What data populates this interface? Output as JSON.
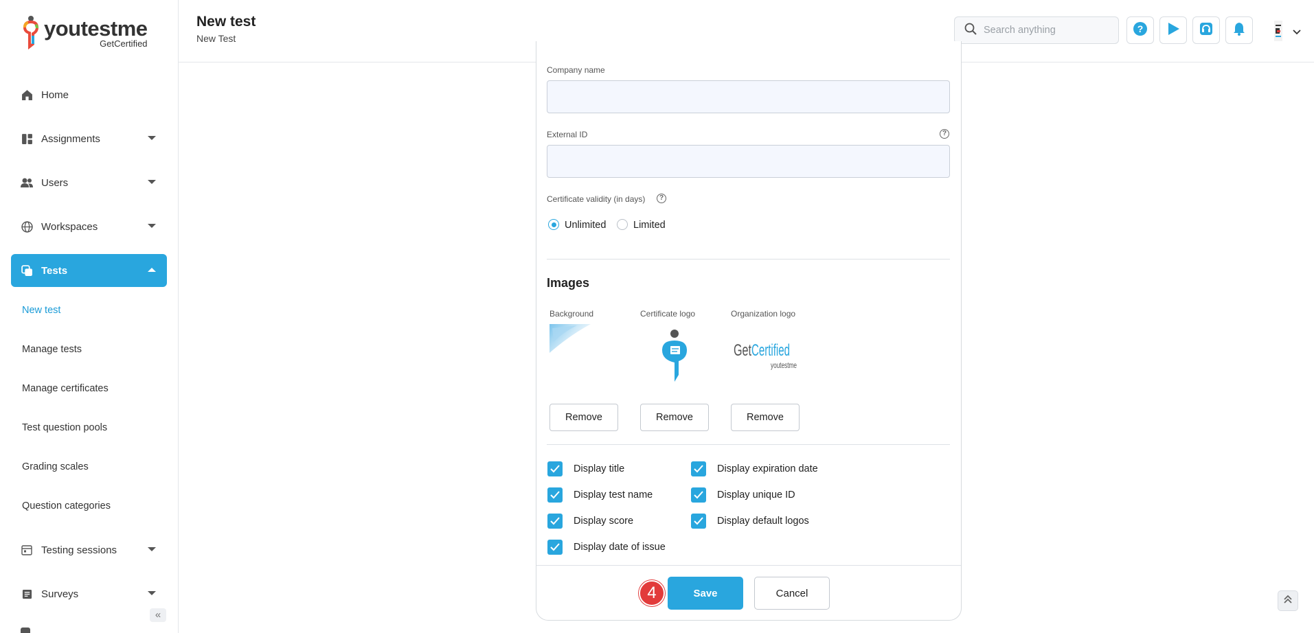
{
  "brand": {
    "name": "youtestme",
    "sub": "GetCertified"
  },
  "sidebar": {
    "items": [
      {
        "label": "Home",
        "icon": "home-icon"
      },
      {
        "label": "Assignments",
        "icon": "assignments-icon"
      },
      {
        "label": "Users",
        "icon": "users-icon"
      },
      {
        "label": "Workspaces",
        "icon": "globe-icon"
      },
      {
        "label": "Tests",
        "icon": "tests-icon"
      },
      {
        "label": "Testing sessions",
        "icon": "calendar-icon"
      },
      {
        "label": "Surveys",
        "icon": "surveys-icon"
      }
    ],
    "sub_items": [
      "New test",
      "Manage tests",
      "Manage certificates",
      "Test question pools",
      "Grading scales",
      "Question categories"
    ]
  },
  "header": {
    "title": "New test",
    "subtitle": "New Test",
    "search_placeholder": "Search anything"
  },
  "form": {
    "company_label": "Company name",
    "company_value": "",
    "external_id_label": "External ID",
    "external_id_value": "",
    "validity_label": "Certificate validity (in days)",
    "validity_options": [
      "Unlimited",
      "Limited"
    ],
    "validity_selected": "Unlimited",
    "images_title": "Images",
    "image_labels": [
      "Background",
      "Certificate logo",
      "Organization logo"
    ],
    "remove_label": "Remove",
    "org_logo_text": {
      "main_left": "Get",
      "main_right": "Certified",
      "sub": "youtestme"
    },
    "checkboxes": [
      {
        "label": "Display title",
        "checked": true
      },
      {
        "label": "Display test name",
        "checked": true
      },
      {
        "label": "Display score",
        "checked": true
      },
      {
        "label": "Display date of issue",
        "checked": true
      },
      {
        "label": "Display expiration date",
        "checked": true
      },
      {
        "label": "Display unique ID",
        "checked": true
      },
      {
        "label": "Display default logos",
        "checked": true
      }
    ]
  },
  "footer": {
    "step": "4",
    "save_label": "Save",
    "cancel_label": "Cancel"
  },
  "colors": {
    "accent": "#29a6de",
    "badge": "#e23b3b",
    "input_bg": "#f4f7fe"
  }
}
